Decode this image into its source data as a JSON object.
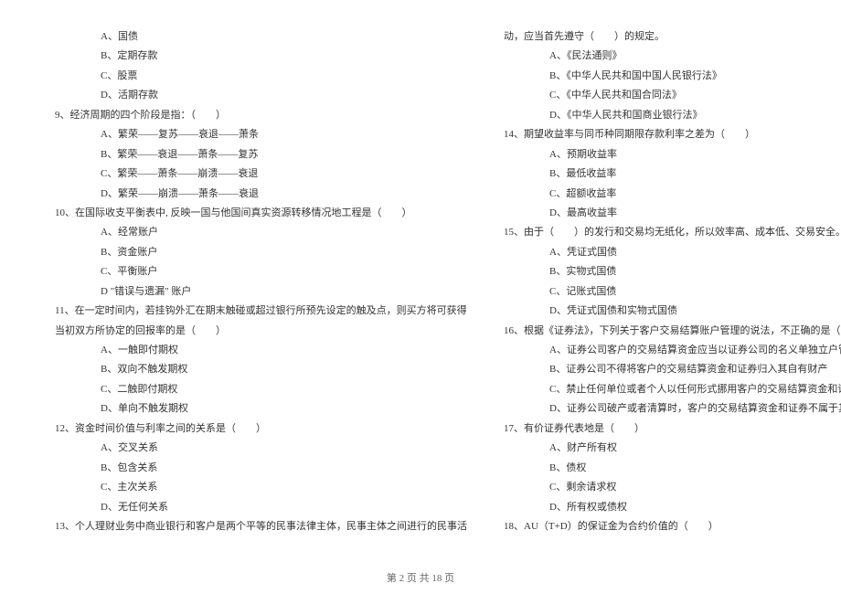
{
  "leftColumn": [
    {
      "cls": "opt",
      "text": "A、国债"
    },
    {
      "cls": "opt",
      "text": "B、定期存款"
    },
    {
      "cls": "opt",
      "text": "C、股票"
    },
    {
      "cls": "opt",
      "text": "D、活期存款"
    },
    {
      "cls": "q",
      "text": "9、经济周期的四个阶段是指：（　　）"
    },
    {
      "cls": "opt",
      "text": "A、繁荣——复苏——衰退——萧条"
    },
    {
      "cls": "opt",
      "text": "B、繁荣——衰退——萧条——复苏"
    },
    {
      "cls": "opt",
      "text": "C、繁荣——萧条——崩溃——衰退"
    },
    {
      "cls": "opt",
      "text": "D、繁荣——崩溃——萧条——衰退"
    },
    {
      "cls": "q",
      "text": "10、在国际收支平衡表中, 反映一国与他国间真实资源转移情况地工程是（　　）"
    },
    {
      "cls": "opt",
      "text": "A、经常账户"
    },
    {
      "cls": "opt",
      "text": "B、资金账户"
    },
    {
      "cls": "opt",
      "text": "C、平衡账户"
    },
    {
      "cls": "opt",
      "text": "D \"错误与遗漏\" 账户"
    },
    {
      "cls": "q",
      "text": "11、在一定时间内，若挂钩外汇在期末触碰或超过银行所预先设定的触及点，则买方将可获得"
    },
    {
      "cls": "cont",
      "text": "当初双方所协定的回报率的是（　　）"
    },
    {
      "cls": "opt",
      "text": "A、一触即付期权"
    },
    {
      "cls": "opt",
      "text": "B、双向不触发期权"
    },
    {
      "cls": "opt",
      "text": "C、二触即付期权"
    },
    {
      "cls": "opt",
      "text": "D、单向不触发期权"
    },
    {
      "cls": "q",
      "text": "12、资金时间价值与利率之间的关系是（　　）"
    },
    {
      "cls": "opt",
      "text": "A、交叉关系"
    },
    {
      "cls": "opt",
      "text": "B、包含关系"
    },
    {
      "cls": "opt",
      "text": "C、主次关系"
    },
    {
      "cls": "opt",
      "text": "D、无任何关系"
    },
    {
      "cls": "q",
      "text": "13、个人理财业务中商业银行和客户是两个平等的民事法律主体，民事主体之间进行的民事活"
    }
  ],
  "rightColumn": [
    {
      "cls": "cont",
      "text": "动，应当首先遵守（　　）的规定。"
    },
    {
      "cls": "opt",
      "text": "A、《民法通则》"
    },
    {
      "cls": "opt",
      "text": "B、《中华人民共和国中国人民银行法》"
    },
    {
      "cls": "opt",
      "text": "C、《中华人民共和国合同法》"
    },
    {
      "cls": "opt",
      "text": "D、《中华人民共和国商业银行法》"
    },
    {
      "cls": "q",
      "text": "14、期望收益率与同币种同期限存款利率之差为（　　）"
    },
    {
      "cls": "opt",
      "text": "A、预期收益率"
    },
    {
      "cls": "opt",
      "text": "B、最低收益率"
    },
    {
      "cls": "opt",
      "text": "C、超额收益率"
    },
    {
      "cls": "opt",
      "text": "D、最高收益率"
    },
    {
      "cls": "q",
      "text": "15、由于（　　）的发行和交易均无纸化，所以效率高、成本低、交易安全。"
    },
    {
      "cls": "opt",
      "text": "A、凭证式国债"
    },
    {
      "cls": "opt",
      "text": "B、实物式国债"
    },
    {
      "cls": "opt",
      "text": "C、记账式国债"
    },
    {
      "cls": "opt",
      "text": "D、凭证式国债和实物式国债"
    },
    {
      "cls": "q",
      "text": "16、根据《证券法》，下列关于客户交易结算账户管理的说法，不正确的是（　　）"
    },
    {
      "cls": "opt",
      "text": "A、证券公司客户的交易结算资金应当以证券公司的名义单独立户管理"
    },
    {
      "cls": "opt",
      "text": "B、证券公司不得将客户的交易结算资金和证券归入其自有财产"
    },
    {
      "cls": "opt",
      "text": "C、禁止任何单位或者个人以任何形式挪用客户的交易结算资金和证券"
    },
    {
      "cls": "opt",
      "text": "D、证券公司破产或者清算时，客户的交易结算资金和证券不属于其破产财产或者清算财产"
    },
    {
      "cls": "q",
      "text": "17、有价证券代表地是（　　）"
    },
    {
      "cls": "opt",
      "text": "A、财产所有权"
    },
    {
      "cls": "opt",
      "text": "B、债权"
    },
    {
      "cls": "opt",
      "text": "C、剩余请求权"
    },
    {
      "cls": "opt",
      "text": "D、所有权或债权"
    },
    {
      "cls": "q",
      "text": "18、AU（T+D）的保证金为合约价值的（　　）"
    }
  ],
  "footer": "第 2 页 共 18 页"
}
